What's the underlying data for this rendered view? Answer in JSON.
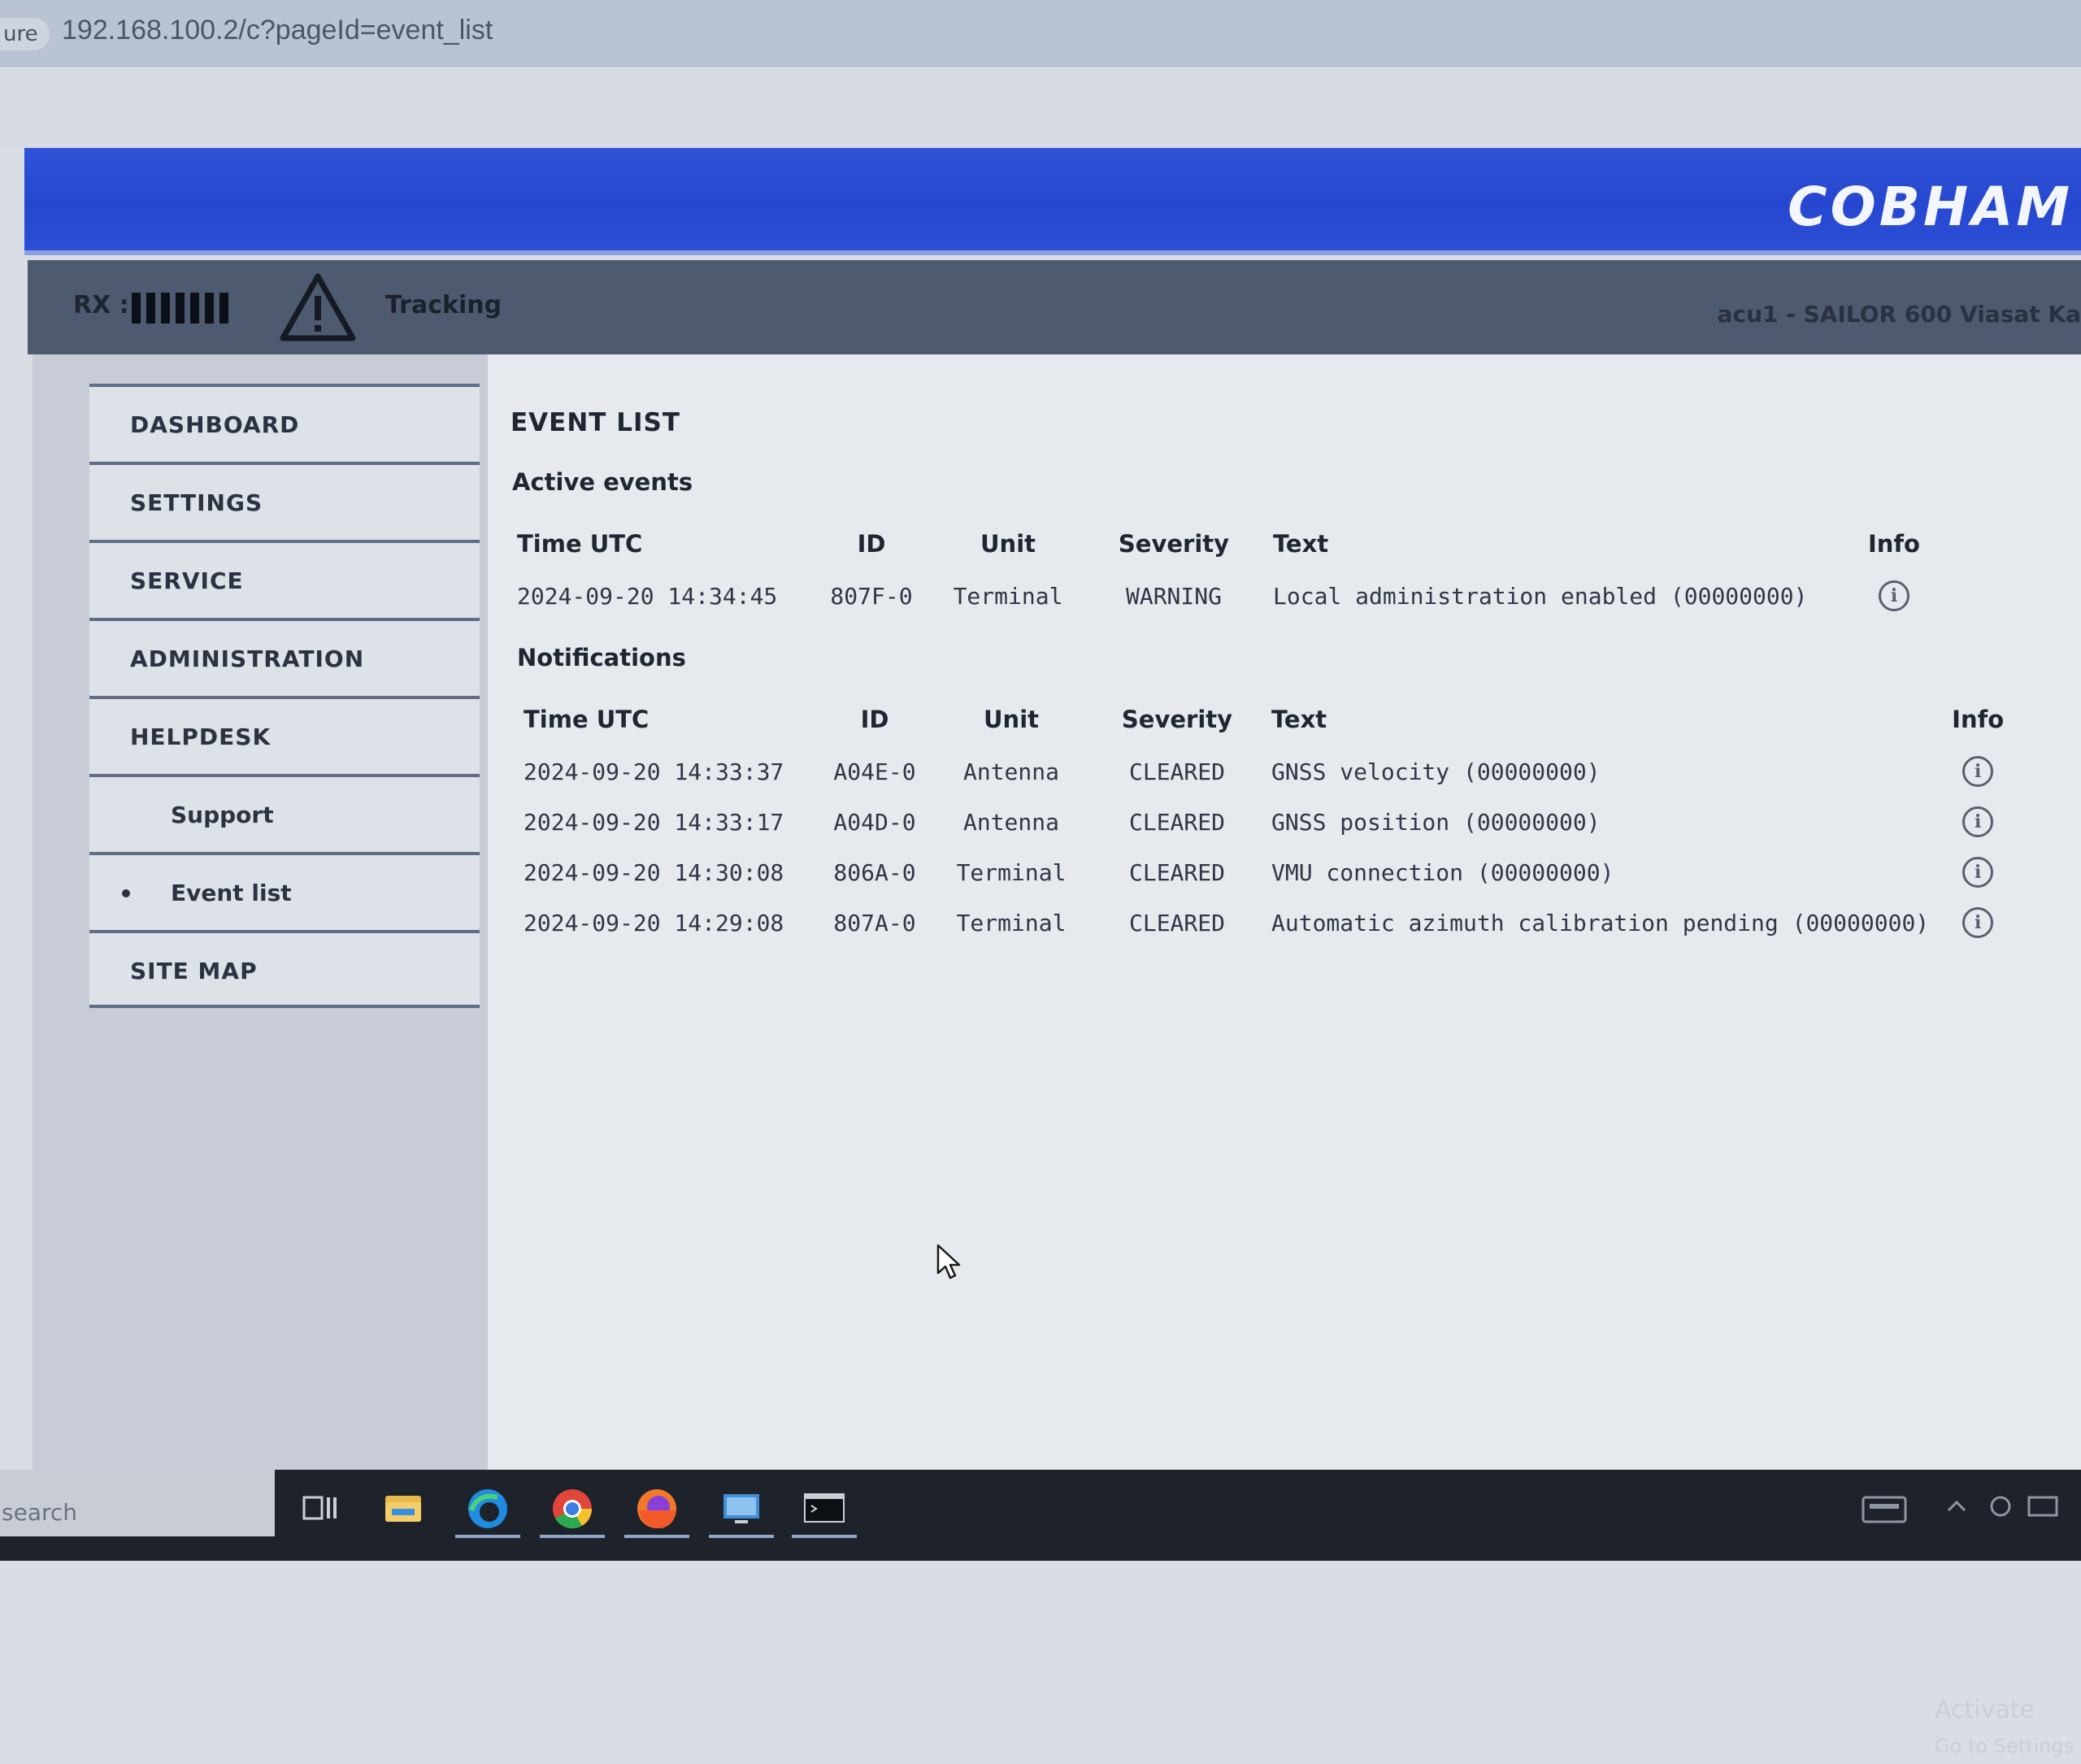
{
  "browser": {
    "secure_label": "ure",
    "url": "192.168.100.2/c?pageId=event_list"
  },
  "brand": {
    "logo": "COBHAM"
  },
  "status": {
    "rx_label": "RX :",
    "tracking_label": "Tracking",
    "device_name": "acu1 - SAILOR 600 Viasat Ka"
  },
  "sidebar": {
    "items": [
      {
        "label": "DASHBOARD"
      },
      {
        "label": "SETTINGS"
      },
      {
        "label": "SERVICE"
      },
      {
        "label": "ADMINISTRATION"
      },
      {
        "label": "HELPDESK"
      },
      {
        "label": "Support"
      },
      {
        "label": "Event list"
      },
      {
        "label": "SITE MAP"
      }
    ]
  },
  "main": {
    "title": "EVENT LIST",
    "active": {
      "heading": "Active events",
      "columns": [
        "Time UTC",
        "ID",
        "Unit",
        "Severity",
        "Text",
        "Info"
      ],
      "rows": [
        {
          "time": "2024-09-20 14:34:45",
          "id": "807F-0",
          "unit": "Terminal",
          "severity": "WARNING",
          "text": "Local administration enabled (00000000)"
        }
      ]
    },
    "notifications": {
      "heading": "Notifications",
      "columns": [
        "Time UTC",
        "ID",
        "Unit",
        "Severity",
        "Text",
        "Info"
      ],
      "rows": [
        {
          "time": "2024-09-20 14:33:37",
          "id": "A04E-0",
          "unit": "Antenna",
          "severity": "CLEARED",
          "text": "GNSS velocity (00000000)"
        },
        {
          "time": "2024-09-20 14:33:17",
          "id": "A04D-0",
          "unit": "Antenna",
          "severity": "CLEARED",
          "text": "GNSS position (00000000)"
        },
        {
          "time": "2024-09-20 14:30:08",
          "id": "806A-0",
          "unit": "Terminal",
          "severity": "CLEARED",
          "text": "VMU connection (00000000)"
        },
        {
          "time": "2024-09-20 14:29:08",
          "id": "807A-0",
          "unit": "Terminal",
          "severity": "CLEARED",
          "text": "Automatic azimuth calibration pending (00000000)"
        }
      ]
    },
    "info_glyph": "i"
  },
  "watermark": {
    "line1": "Activate",
    "line2": "Go to Settings"
  },
  "taskbar": {
    "search_label": "search",
    "icons": [
      "task-view-icon",
      "file-explorer-icon",
      "edge-icon",
      "chrome-icon",
      "firefox-icon",
      "remote-desktop-icon",
      "terminal-icon"
    ]
  },
  "colors": {
    "brand_blue": "#2a4cd4",
    "status_bar": "#4e5a6f",
    "nav_border": "#5f6d86"
  }
}
